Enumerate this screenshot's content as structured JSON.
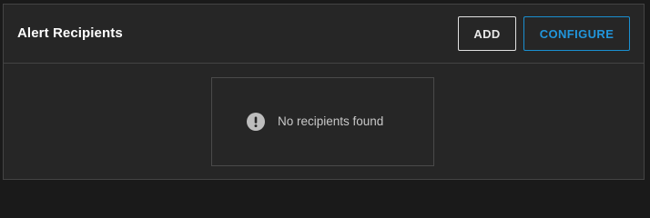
{
  "panel": {
    "title": "Alert Recipients",
    "actions": {
      "add_label": "ADD",
      "configure_label": "CONFIGURE"
    },
    "empty_state": {
      "icon": "exclamation-circle-icon",
      "message": "No recipients found"
    }
  },
  "colors": {
    "background": "#262626",
    "border": "#444444",
    "accent": "#2196dc",
    "text": "#ffffff",
    "muted_text": "#c8c8c8"
  }
}
